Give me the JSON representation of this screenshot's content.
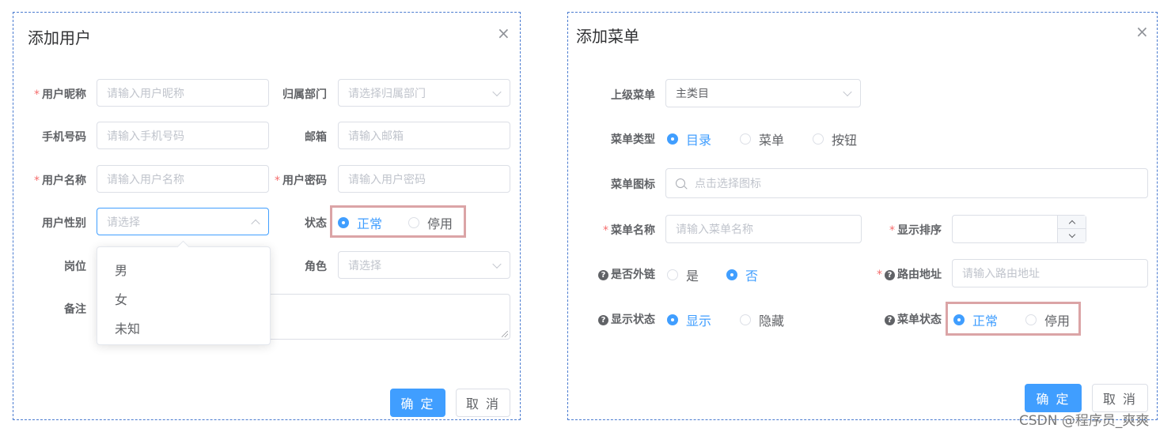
{
  "user_dialog": {
    "title": "添加用户",
    "close_glyph": "×",
    "nickname": {
      "label": "用户昵称",
      "required": "*",
      "placeholder": "请输入用户昵称"
    },
    "dept": {
      "label": "归属部门",
      "placeholder": "请选择归属部门"
    },
    "phone": {
      "label": "手机号码",
      "placeholder": "请输入手机号码"
    },
    "email": {
      "label": "邮箱",
      "placeholder": "请输入邮箱"
    },
    "username": {
      "label": "用户名称",
      "required": "*",
      "placeholder": "请输入用户名称"
    },
    "password": {
      "label": "用户密码",
      "required": "*",
      "placeholder": "请输入用户密码"
    },
    "gender": {
      "label": "用户性别",
      "placeholder": "请选择",
      "options": [
        "男",
        "女",
        "未知"
      ]
    },
    "status": {
      "label": "状态",
      "options": [
        "正常",
        "停用"
      ],
      "selected": "正常"
    },
    "post": {
      "label": "岗位"
    },
    "role": {
      "label": "角色",
      "placeholder": "请选择"
    },
    "remark": {
      "label": "备注"
    },
    "confirm": "确 定",
    "cancel": "取 消"
  },
  "menu_dialog": {
    "title": "添加菜单",
    "close_glyph": "×",
    "parent": {
      "label": "上级菜单",
      "value": "主类目"
    },
    "menu_type": {
      "label": "菜单类型",
      "options": [
        "目录",
        "菜单",
        "按钮"
      ],
      "selected": "目录"
    },
    "icon": {
      "label": "菜单图标",
      "placeholder": "点击选择图标"
    },
    "menu_name": {
      "label": "菜单名称",
      "required": "*",
      "placeholder": "请输入菜单名称"
    },
    "order": {
      "label": "显示排序",
      "required": "*"
    },
    "external": {
      "label": "是否外链",
      "help_glyph": "?",
      "options": [
        "是",
        "否"
      ],
      "selected": "否"
    },
    "route": {
      "label": "路由地址",
      "required": "*",
      "help_glyph": "?",
      "placeholder": "请输入路由地址"
    },
    "visible": {
      "label": "显示状态",
      "help_glyph": "?",
      "options": [
        "显示",
        "隐藏"
      ],
      "selected": "显示"
    },
    "menu_status": {
      "label": "菜单状态",
      "help_glyph": "?",
      "options": [
        "正常",
        "停用"
      ],
      "selected": "正常"
    },
    "confirm": "确 定",
    "cancel": "取 消"
  },
  "watermark": "CSDN @程序员_爽爽",
  "colors": {
    "primary": "#409eff",
    "required": "#f56c6c",
    "highlight": "#dba4a6",
    "dialog_border": "#4a7bd0"
  }
}
